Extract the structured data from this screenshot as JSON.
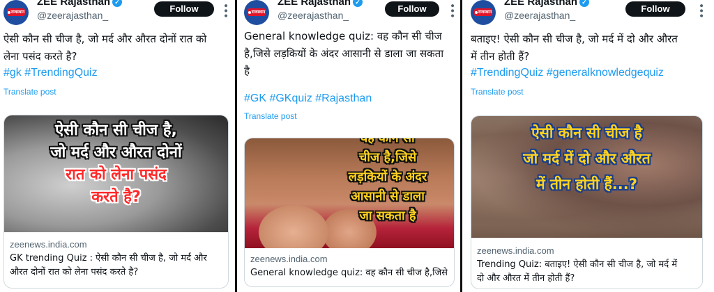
{
  "account": {
    "name": "ZEE Rajasthan",
    "handle": "@zeerajasthan_",
    "avatar_badge": "राजस्थान",
    "follow_label": "Follow"
  },
  "posts": [
    {
      "text_lines": [
        "ऐसी कौन सी चीज है, जो मर्द और औरत दोनों रात को",
        "लेना पसंद करते है?"
      ],
      "hashtags": "#gk  #TrendingQuiz",
      "translate": "Translate post",
      "card": {
        "image_lines": [
          "ऐसी कौन सी चीज है,",
          "जो मर्द और औरत दोनों",
          "रात को लेना पसंद",
          "करते है?"
        ],
        "domain": "zeenews.india.com",
        "title_lines": [
          "GK trending Quiz : ऐसी कौन सी चीज है, जो मर्द और",
          "औरत दोनों रात को लेना पसंद करते है?"
        ]
      }
    },
    {
      "text_lines": [
        "General knowledge quiz: वह कौन सी चीज",
        "है,जिसे लड़कियों के अंदर आसानी से डाला जा सकता",
        "है"
      ],
      "hashtags": "#GK #GKquiz #Rajasthan",
      "translate": "Translate post",
      "card": {
        "image_lines": [
          "वह कौन सी",
          "चीज है,जिसे",
          "लड़कियों के अंदर",
          "आसानी से डाला",
          "जा सकता है"
        ],
        "domain": "zeenews.india.com",
        "title_lines": [
          "General knowledge quiz: वह कौन सी चीज है,जिसे"
        ]
      }
    },
    {
      "text_lines": [
        "बताइए! ऐसी कौन सी चीज है, जो मर्द में दो और औरत",
        "में तीन होती हैं?"
      ],
      "hashtags": "#TrendingQuiz  #generalknowledgequiz",
      "translate": "Translate post",
      "card": {
        "image_lines": [
          "ऐसी कौन सी चीज है",
          "जो मर्द में दो और औरत",
          "में तीन होती हैं...?"
        ],
        "domain": "zeenews.india.com",
        "title_lines": [
          "Trending Quiz: बताइए! ऐसी कौन सी चीज है, जो मर्द में",
          "दो और औरत में तीन होती हैं?"
        ]
      }
    }
  ],
  "colors": {
    "link": "#1d9bf0",
    "secondary": "#536471",
    "follow_bg": "#0f1419",
    "verified": "#1d9bf0"
  },
  "icons": {
    "verified": "verified-badge-icon",
    "more": "more-options-icon"
  }
}
